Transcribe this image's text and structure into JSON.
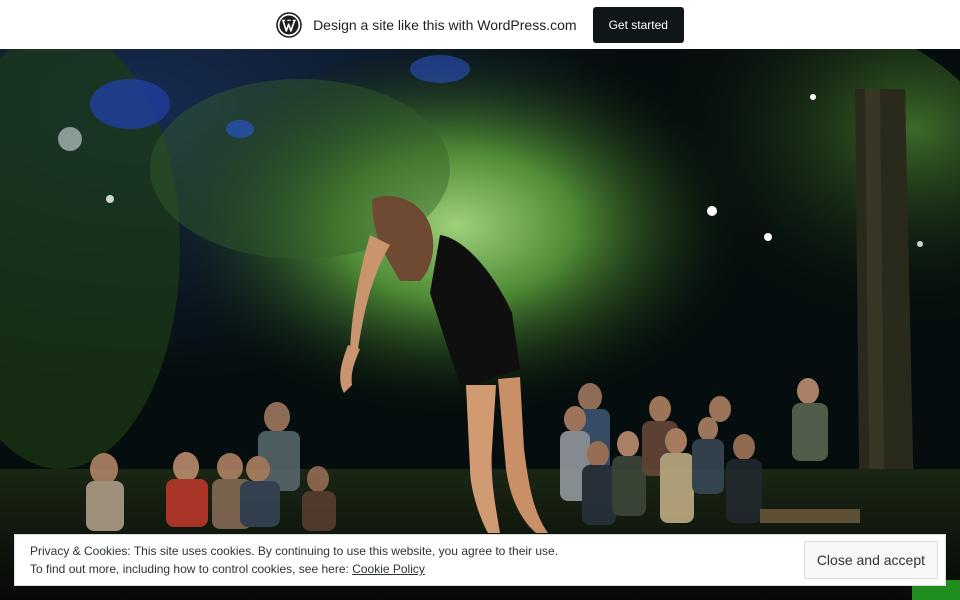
{
  "banner": {
    "logo_icon": "wordpress-logo-icon",
    "text": "Design a site like this with WordPress.com",
    "button_label": "Get started"
  },
  "hero": {
    "image_subject": "dancer-performing-outdoors-at-night"
  },
  "cookie": {
    "line1": "Privacy & Cookies: This site uses cookies. By continuing to use this website, you agree to their use.",
    "line2_prefix": "To find out more, including how to control cookies, see here: ",
    "link_label": "Cookie Policy",
    "button_label": "Close and accept"
  },
  "colors": {
    "banner_bg": "#ffffff",
    "button_dark": "#101517",
    "accent_green": "#1f8e1f"
  }
}
